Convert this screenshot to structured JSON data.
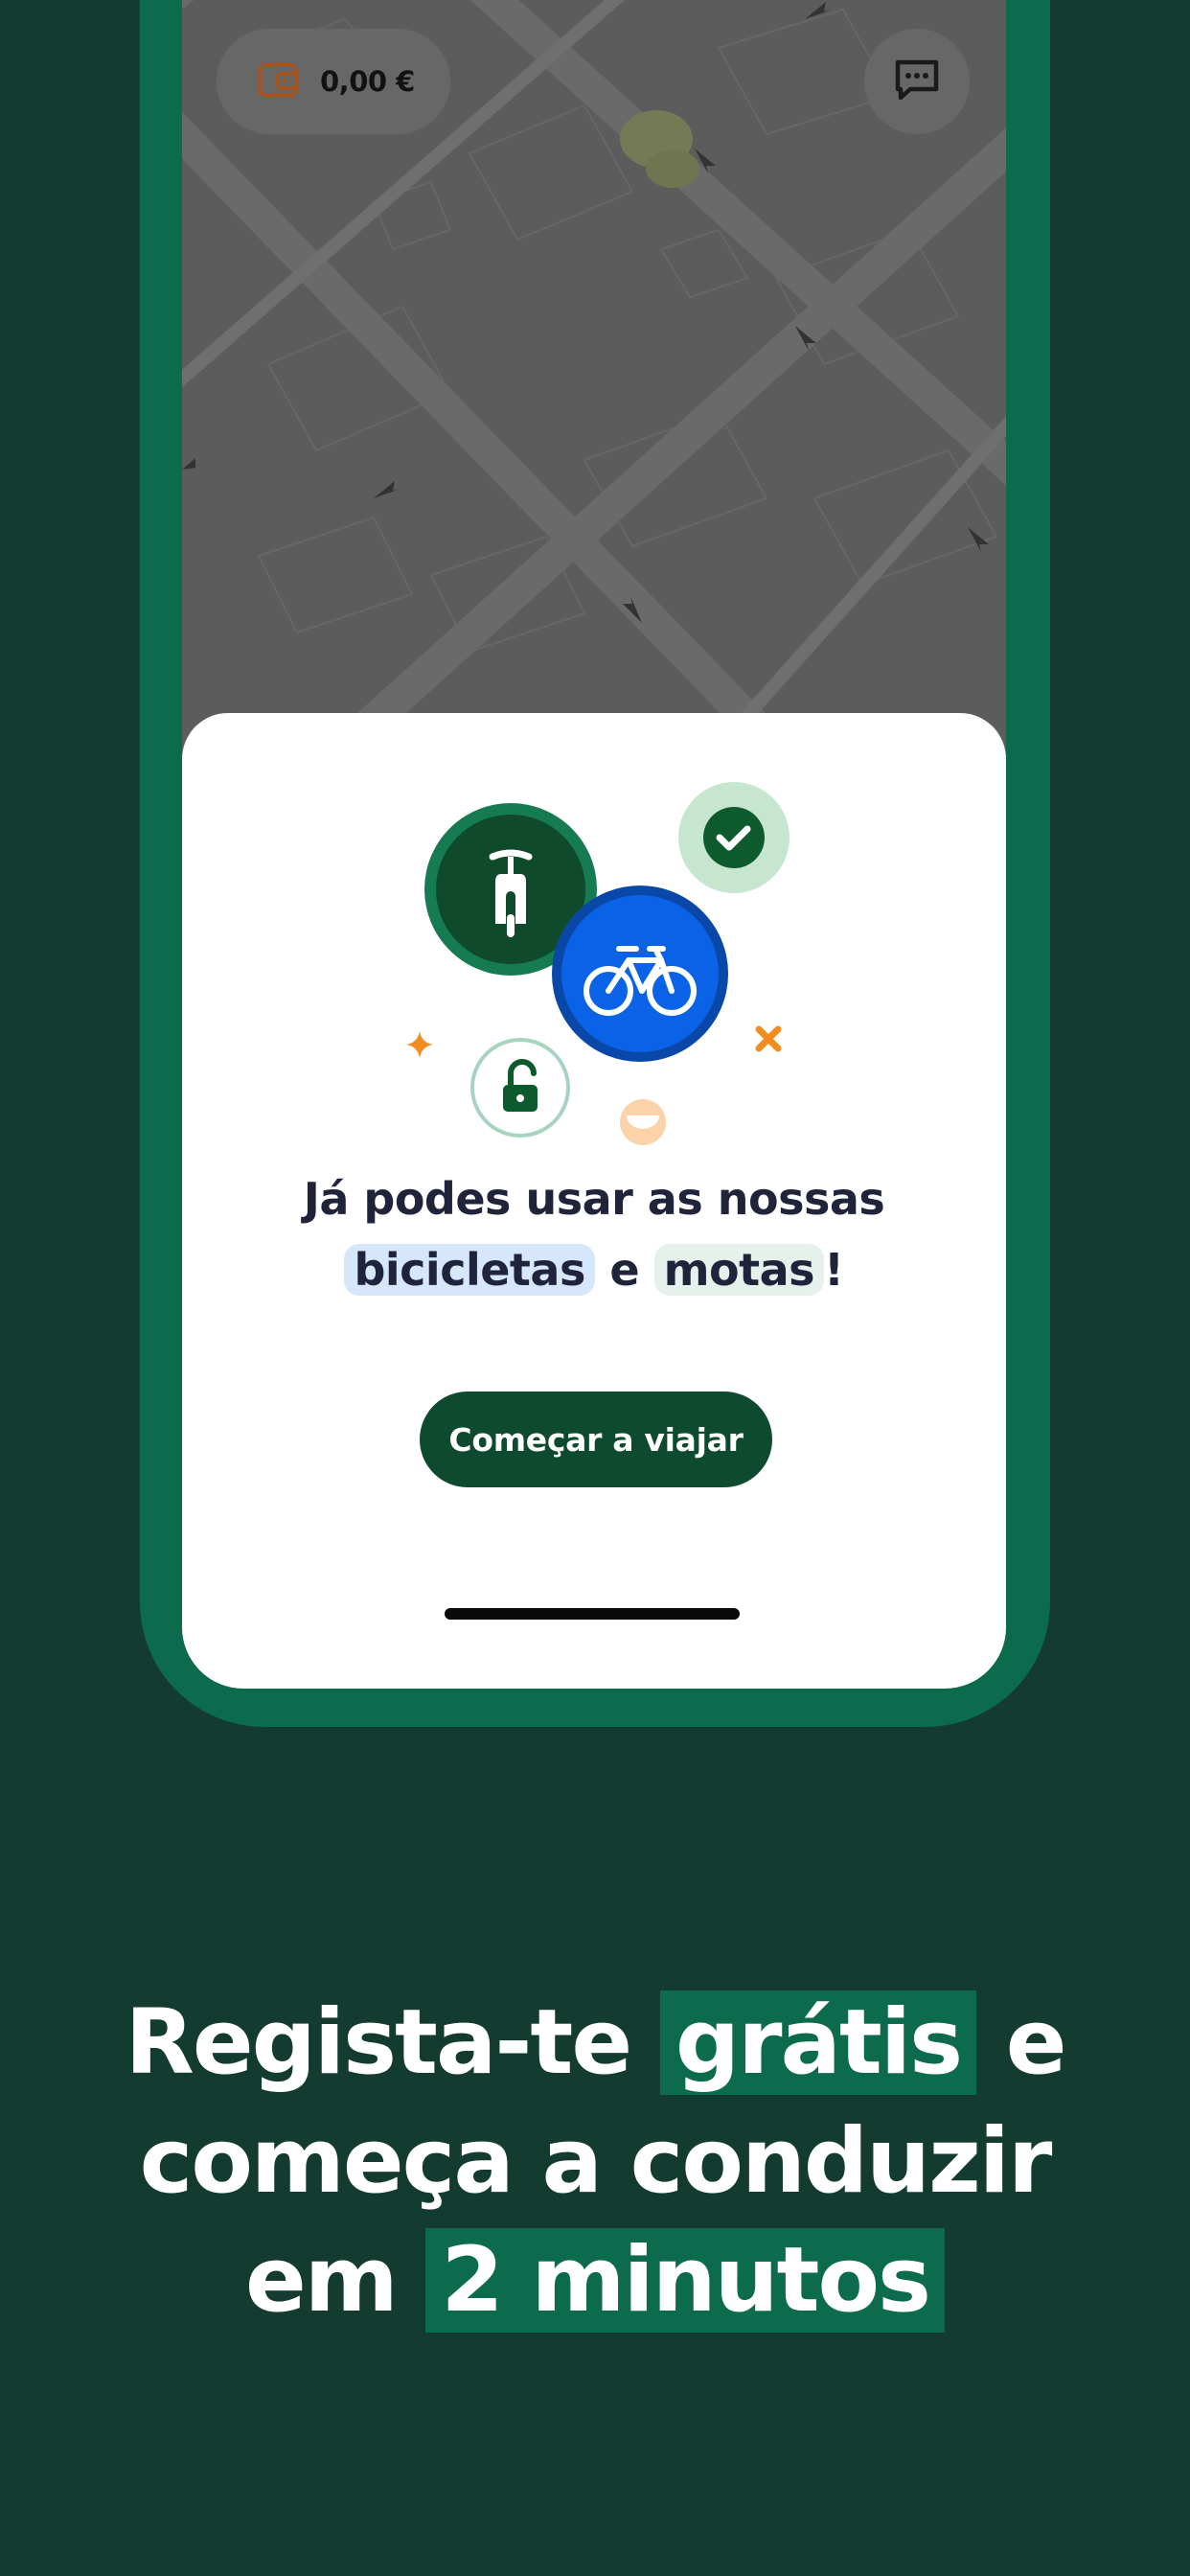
{
  "topbar": {
    "wallet_balance": "0,00 €",
    "wallet_icon": "wallet-icon",
    "chat_icon": "chat-icon"
  },
  "modal": {
    "headline_part1": "Já podes usar as nossas",
    "highlight_bikes": "bicicletas",
    "connector": "e",
    "highlight_motos": "motas",
    "exclamation": "!",
    "cta_label": "Começar a viajar",
    "icons": [
      "scooter-icon",
      "bicycle-icon",
      "check-icon",
      "unlock-icon",
      "sparkle-icon",
      "cross-icon",
      "smile-icon"
    ]
  },
  "promo": {
    "line1_a": "Regista-te",
    "line1_highlight": "grátis",
    "line1_b": "e",
    "line2": "começa a conduzir",
    "line3_a": "em",
    "line3_highlight": "2 minutos"
  },
  "colors": {
    "background": "#133b30",
    "frame": "#0b6b4c",
    "cta": "#0d4a2f",
    "bike_blue": "#0a63e6",
    "accent_orange": "#f28c1e",
    "highlight_blue": "#d6e7fb",
    "highlight_green": "#e6f1ec"
  }
}
